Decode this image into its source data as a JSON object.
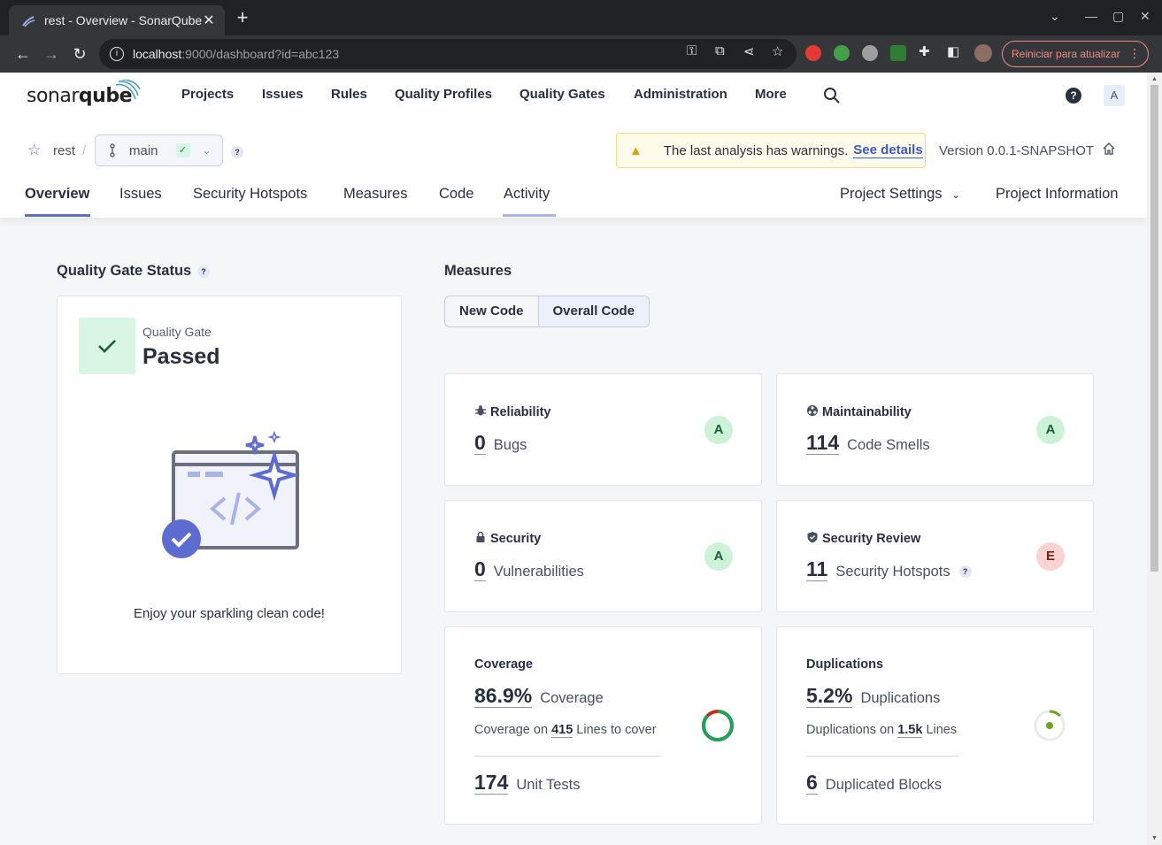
{
  "browser": {
    "tab_title": "rest - Overview - SonarQube",
    "url_host": "localhost",
    "url_rest": ":9000/dashboard?id=abc123",
    "restart_label": "Reiniciar para atualizar"
  },
  "nav": {
    "logo_light": "sonar",
    "logo_bold": "qube",
    "items": [
      "Projects",
      "Issues",
      "Rules",
      "Quality Profiles",
      "Quality Gates",
      "Administration",
      "More"
    ],
    "avatar": "A",
    "help": "?"
  },
  "project": {
    "name": "rest",
    "separator": "/",
    "branch": "main",
    "branch_help": "?",
    "warning_text": "The last analysis has warnings.",
    "warning_link": "See details",
    "version": "Version 0.0.1-SNAPSHOT",
    "tabs": [
      "Overview",
      "Issues",
      "Security Hotspots",
      "Measures",
      "Code",
      "Activity"
    ],
    "settings_tab": "Project Settings",
    "info_tab": "Project Information"
  },
  "quality_gate": {
    "title": "Quality Gate Status",
    "help": "?",
    "label": "Quality Gate",
    "status": "Passed",
    "message": "Enjoy your sparkling clean code!",
    "status_color": "#1f8a4a"
  },
  "measures": {
    "title": "Measures",
    "toggle": [
      "New Code",
      "Overall Code"
    ],
    "selected": "Overall Code",
    "reliability": {
      "title": "Reliability",
      "value": "0",
      "unit": "Bugs",
      "rating": "A"
    },
    "maintainability": {
      "title": "Maintainability",
      "value": "114",
      "unit": "Code Smells",
      "rating": "A"
    },
    "security": {
      "title": "Security",
      "value": "0",
      "unit": "Vulnerabilities",
      "rating": "A"
    },
    "security_review": {
      "title": "Security Review",
      "value": "11",
      "unit": "Security Hotspots",
      "help": "?",
      "rating": "E"
    },
    "coverage": {
      "title": "Coverage",
      "value": "86.9%",
      "unit": "Coverage",
      "sub_prefix": "Coverage on",
      "sub_value": "415",
      "sub_suffix": "Lines to cover",
      "tests_value": "174",
      "tests_unit": "Unit Tests",
      "percent": 86.9
    },
    "duplications": {
      "title": "Duplications",
      "value": "5.2%",
      "unit": "Duplications",
      "sub_prefix": "Duplications on",
      "sub_value": "1.5k",
      "sub_suffix": "Lines",
      "blocks_value": "6",
      "blocks_unit": "Duplicated Blocks",
      "percent": 5.2
    }
  },
  "colors": {
    "accent": "#5d6cd0",
    "rating_a_bg": "#ccf2d8",
    "rating_e_bg": "#fbd3d1",
    "coverage_good": "#1fa35a",
    "coverage_bad": "#c42b1c",
    "duplication": "#6aa61a"
  }
}
